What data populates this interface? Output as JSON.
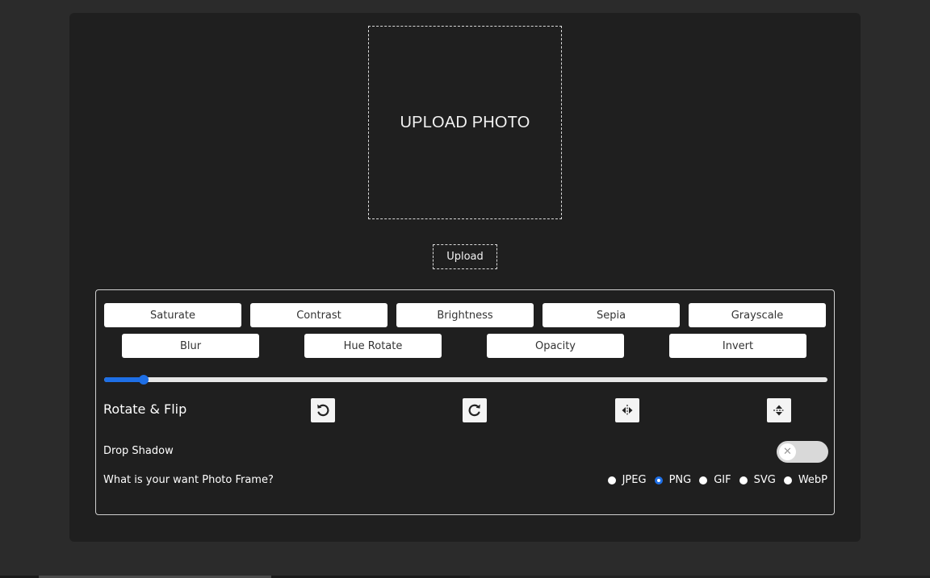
{
  "upload": {
    "placeholder_text": "UPLOAD PHOTO",
    "button_label": "Upload"
  },
  "filters": {
    "row1": [
      "Saturate",
      "Contrast",
      "Brightness",
      "Sepia",
      "Grayscale"
    ],
    "row2": [
      "Blur",
      "Hue Rotate",
      "Opacity",
      "Invert"
    ]
  },
  "slider": {
    "value_fraction": 0.055,
    "accent": "#1e6fe6"
  },
  "rotate": {
    "label": "Rotate & Flip",
    "buttons": [
      "rotate-left-icon",
      "rotate-right-icon",
      "flip-horizontal-icon",
      "flip-vertical-icon"
    ]
  },
  "shadow": {
    "label": "Drop Shadow",
    "enabled": false
  },
  "frame": {
    "label": "What is your want Photo Frame?",
    "options": [
      "JPEG",
      "PNG",
      "GIF",
      "SVG",
      "WebP"
    ],
    "selected": "PNG"
  },
  "colors": {
    "background": "#2b2b2b",
    "panel": "#1f1f1f",
    "accent": "#1e6fe6"
  }
}
